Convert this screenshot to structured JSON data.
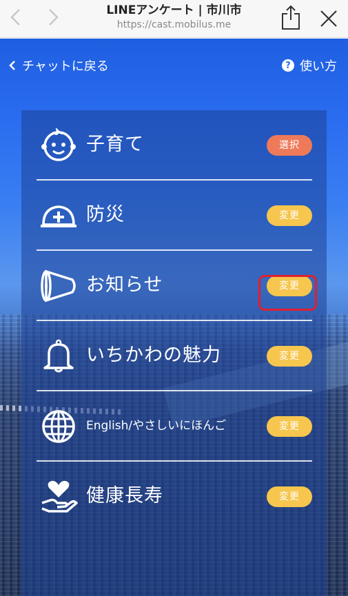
{
  "browser": {
    "title": "LINEアンケート | 市川市",
    "url": "https://cast.mobilus.me"
  },
  "topnav": {
    "back_label": "チャットに戻る",
    "help_label": "使い方",
    "help_icon_glyph": "?"
  },
  "categories": [
    {
      "label": "子育て",
      "icon": "baby-face-icon",
      "action": "選択",
      "action_color": "#ee7a5a"
    },
    {
      "label": "防災",
      "icon": "helmet-icon",
      "action": "変更",
      "action_color": "#f6c64e"
    },
    {
      "label": "お知らせ",
      "icon": "megaphone-icon",
      "action": "変更",
      "action_color": "#f6c64e"
    },
    {
      "label": "いちかわの魅力",
      "icon": "bell-icon",
      "action": "変更",
      "action_color": "#f6c64e"
    },
    {
      "label": "English/やさしいにほんご",
      "icon": "globe-icon",
      "action": "変更",
      "action_color": "#f6c64e"
    },
    {
      "label": "健康長寿",
      "icon": "heart-hand-icon",
      "action": "変更",
      "action_color": "#f6c64e"
    }
  ],
  "highlighted_row": 2
}
